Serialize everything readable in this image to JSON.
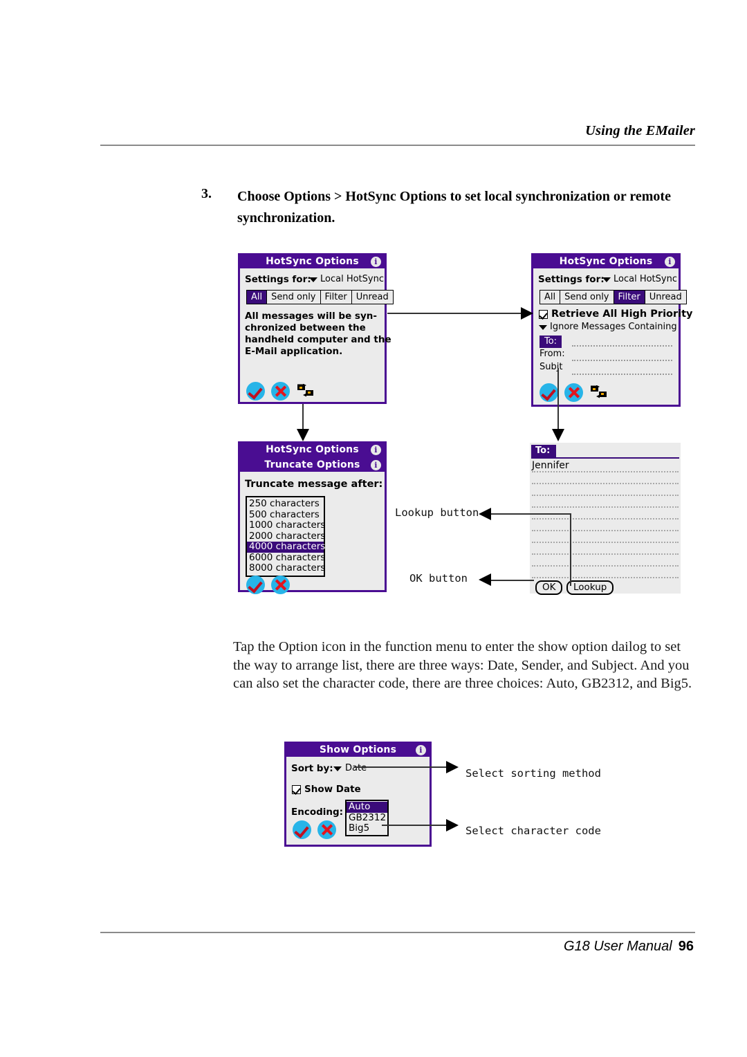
{
  "header": {
    "title": "Using the EMailer"
  },
  "footer": {
    "manual": "G18 User Manual",
    "page": "96"
  },
  "step": {
    "number": "3.",
    "text": "Choose Options > HotSync Options to set local synchronization or remote synchronization."
  },
  "paragraph": {
    "text": "Tap the Option icon in the function menu to enter the show option dailog to set the way to arrange list, there are three ways: Date, Sender, and Subject. And you can also set the character code, there are three choices: Auto, GB2312, and  Big5."
  },
  "dialog_hotsync_all": {
    "title": "HotSync Options",
    "info_icon": "i",
    "settings_label": "Settings for:",
    "settings_value": "Local HotSync",
    "tabs": [
      {
        "label": "All",
        "selected": true
      },
      {
        "label": "Send only",
        "selected": false
      },
      {
        "label": "Filter",
        "selected": false
      },
      {
        "label": "Unread",
        "selected": false
      }
    ],
    "description_lines": [
      "All messages will be syn-",
      "chronized between the",
      "handheld computer and the",
      "E-Mail application."
    ],
    "ok_icon": "check-icon",
    "cancel_icon": "x-icon",
    "hotsync_icon": "hotsync-icon"
  },
  "dialog_hotsync_filter": {
    "title": "HotSync Options",
    "info_icon": "i",
    "settings_label": "Settings for:",
    "settings_value": "Local HotSync",
    "tabs": [
      {
        "label": "All",
        "selected": false
      },
      {
        "label": "Send only",
        "selected": false
      },
      {
        "label": "Filter",
        "selected": true
      },
      {
        "label": "Unread",
        "selected": false
      }
    ],
    "checkbox_label": "Retrieve All High Priority",
    "checkbox_checked": true,
    "popup_label": "Ignore Messages Containing",
    "fields": [
      {
        "label": "To:",
        "highlighted": true,
        "value": ""
      },
      {
        "label": "From:",
        "highlighted": false,
        "value": ""
      },
      {
        "label": "Subjt",
        "highlighted": false,
        "value": ""
      }
    ],
    "ok_icon": "check-icon",
    "cancel_icon": "x-icon",
    "hotsync_icon": "hotsync-icon"
  },
  "dialog_truncate": {
    "back_title": "HotSync Options",
    "title": "Truncate Options",
    "info_icon": "i",
    "heading": "Truncate message after:",
    "options": [
      {
        "label": "250 characters",
        "selected": false
      },
      {
        "label": "500 characters",
        "selected": false
      },
      {
        "label": "1000 characters",
        "selected": false
      },
      {
        "label": "2000 characters",
        "selected": false
      },
      {
        "label": "4000 characters",
        "selected": true
      },
      {
        "label": "6000 characters",
        "selected": false
      },
      {
        "label": "8000 characters",
        "selected": false
      }
    ],
    "ok_icon": "check-icon",
    "cancel_icon": "x-icon"
  },
  "screen_to": {
    "field_tag": "To:",
    "recipient": "Jennifer",
    "buttons": [
      {
        "label": "OK"
      },
      {
        "label": "Lookup"
      }
    ]
  },
  "dialog_show_options": {
    "title": "Show Options",
    "info_icon": "i",
    "sort_label": "Sort by:",
    "sort_value": "Date",
    "show_date_label": "Show Date",
    "show_date_checked": true,
    "encoding_label": "Encoding:",
    "encoding_options": [
      {
        "label": "Auto",
        "selected": true
      },
      {
        "label": "GB2312",
        "selected": false
      },
      {
        "label": "Big5",
        "selected": false
      }
    ],
    "ok_icon": "check-icon",
    "cancel_icon": "x-icon"
  },
  "callouts": {
    "lookup_button": "Lookup button",
    "ok_button": "OK button",
    "select_sorting": "Select sorting method",
    "select_charcode": "Select character code"
  },
  "colors": {
    "title_purple": "#4a0d92",
    "select_purple": "#3a0b7a",
    "button_cyan": "#27b4e8",
    "check_red": "#c01020",
    "x_red": "#e3141e",
    "screen_gray": "#ebebeb"
  }
}
